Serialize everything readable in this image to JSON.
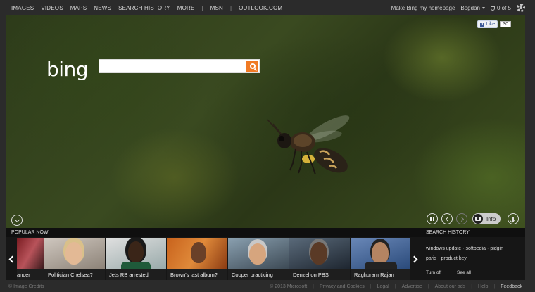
{
  "topnav": {
    "links": [
      "IMAGES",
      "VIDEOS",
      "MAPS",
      "NEWS",
      "SEARCH HISTORY",
      "MORE"
    ],
    "separator": "|",
    "msn": "MSN",
    "outlook": "OUTLOOK.COM"
  },
  "topright": {
    "homepage": "Make Bing my homepage",
    "user": "Bogdan",
    "rewards": "0 of 5"
  },
  "hero": {
    "logo": "bing",
    "search_placeholder": "",
    "fb_like": "Like",
    "fb_count": "30",
    "info_label": "Info"
  },
  "popular": {
    "title": "POPULAR NOW",
    "items": [
      {
        "caption": "ancer"
      },
      {
        "caption": "Politician Chelsea?"
      },
      {
        "caption": "Jets RB arrested"
      },
      {
        "caption": "Brown's last album?"
      },
      {
        "caption": "Cooper practicing"
      },
      {
        "caption": "Denzel on PBS"
      },
      {
        "caption": "Raghuram Rajan"
      }
    ]
  },
  "history": {
    "title": "SEARCH HISTORY",
    "items": [
      "windows update",
      "softpedia",
      "pidgin",
      "paris",
      "product key"
    ],
    "turn_off": "Turn off",
    "see_all": "See all"
  },
  "footer": {
    "credits": "© Image Credits",
    "copyright": "© 2013 Microsoft",
    "links": [
      "Privacy and Cookies",
      "Legal",
      "Advertise",
      "About our ads",
      "Help"
    ],
    "feedback": "Feedback"
  },
  "colors": {
    "accent": "#f07a24",
    "topbar": "#2b2b2b",
    "strip": "#161616"
  }
}
